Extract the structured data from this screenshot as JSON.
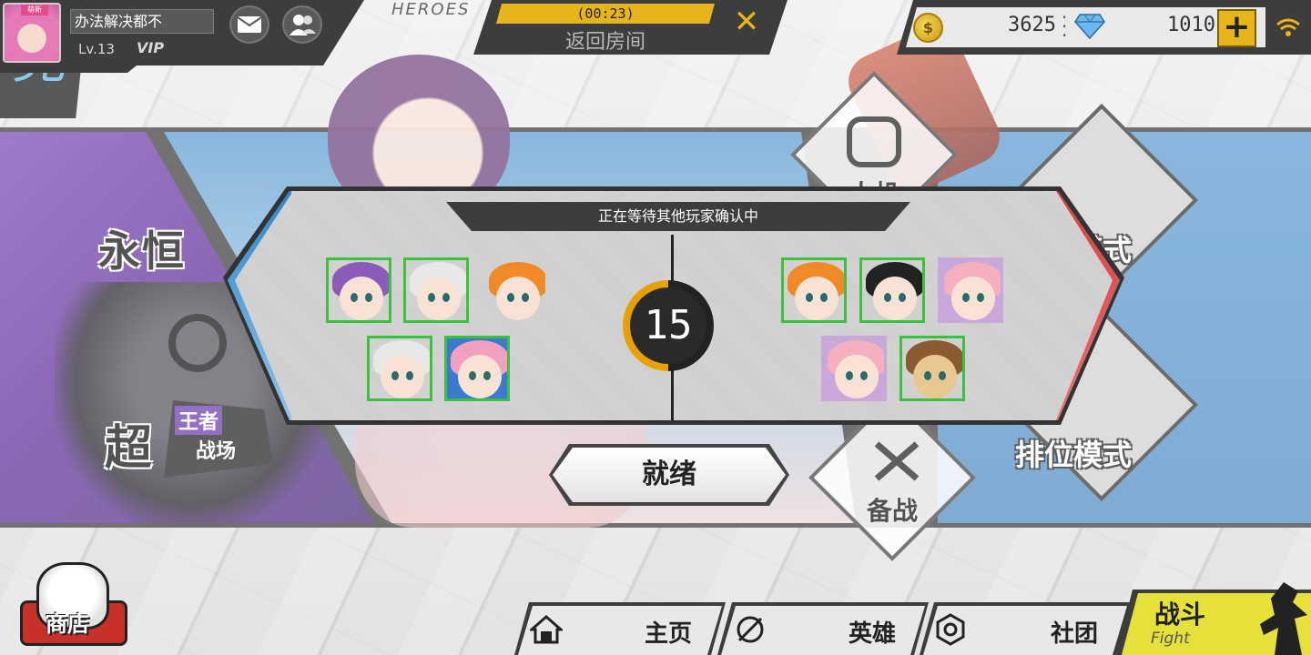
{
  "header": {
    "player_name": "办法解决都不",
    "level": "Lv.13",
    "vip": "VIP",
    "avatar_tag": "萌新",
    "timer": "(00:23)",
    "return_room": "返回房间",
    "heroes_watermark": "HEROES"
  },
  "currency": {
    "gold": "3625",
    "diamonds": "1010",
    "accent": "#e7b41a"
  },
  "modes": {
    "eternal": "永恒",
    "competitive": "竞",
    "super": "超",
    "king_top": "王者",
    "king_bottom": "战场",
    "ai": "人机",
    "match": "匹配模式",
    "ranked": "排位模式",
    "prepare": "备战"
  },
  "dialog": {
    "status": "正在等待其他玩家确认中",
    "countdown": "15",
    "ready": "就绪",
    "team_left_color": "#2c86c8",
    "team_right_color": "#d84040"
  },
  "team_left": [
    {
      "hair": "#8a5cb8",
      "bg": "#b89ad6",
      "confirmed": true
    },
    {
      "hair": "#e8e8e8",
      "bg": "#c7a8d8",
      "confirmed": true
    },
    {
      "hair": "#f08a28",
      "bg": "#e8e8e8",
      "confirmed": false
    },
    {
      "hair": "#e8e8e8",
      "bg": "#c7a8d8",
      "confirmed": true
    },
    {
      "hair": "#f2a0c0",
      "bg": "#3a7ad0",
      "confirmed": true
    }
  ],
  "team_right": [
    {
      "hair": "#f08a28",
      "bg": "#e8e8e8",
      "confirmed": true
    },
    {
      "hair": "#222222",
      "bg": "#c7a8d8",
      "confirmed": true
    },
    {
      "hair": "#f5b0c0",
      "bg": "#c7a8d8",
      "confirmed": false
    },
    {
      "hair": "#f5b0c0",
      "bg": "#c7a8d8",
      "confirmed": false
    },
    {
      "hair": "#8a5a30",
      "bg": "#c7a8d8",
      "confirmed": true
    }
  ],
  "nav": {
    "shop": "商店",
    "home": "主页",
    "heroes": "英雄",
    "club": "社团",
    "fight": "战斗",
    "fight_en": "Fight",
    "fight_color": "#e6e13a"
  }
}
